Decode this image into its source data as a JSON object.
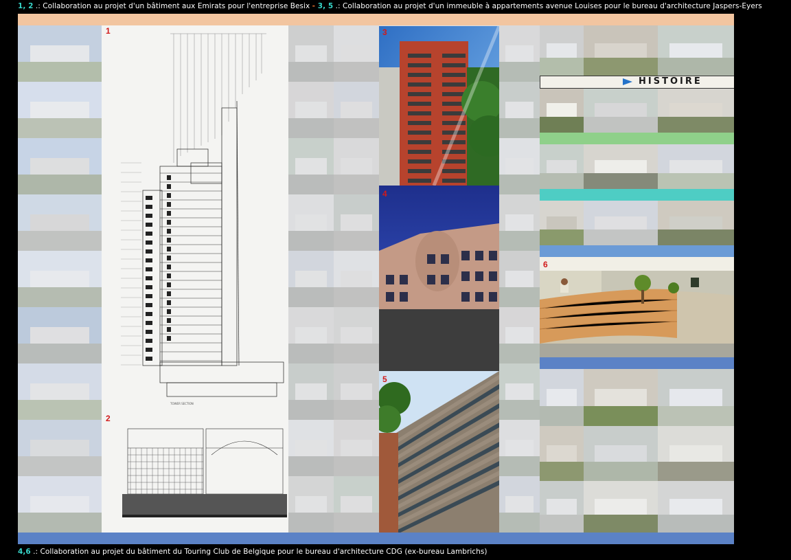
{
  "caption_top": {
    "num1": "1, 2",
    "text1": " .: Collaboration au projet d'un bâtiment aux Emirats pour l'entreprise Besix ",
    "sep": "- ",
    "num2": "3, 5",
    "text2": " .: Collaboration au projet d'un immeuble à appartements avenue Louises pour le bureau d'architecture Jaspers-Eyers"
  },
  "caption_bottom": {
    "num": "4,6",
    "text": " .: Collaboration au projet du bâtiment du Touring Club de Belgique pour le bureau d'architecture CDG (ex-bureau Lambrichs)"
  },
  "labels": {
    "p1": "1",
    "p2": "2",
    "p3": "3",
    "p4": "4",
    "p5": "5",
    "p6": "6"
  },
  "histoire": "HISTOIRE",
  "colors": {
    "accent_cyan": "#37d4c8",
    "accent_orange": "#e06a2a",
    "label_red": "#d11a1a",
    "band_blue": "#5b82c6",
    "band_peach": "#f2c5a0",
    "band_green": "#8fd08a",
    "band_teal": "#4ecdc4"
  }
}
